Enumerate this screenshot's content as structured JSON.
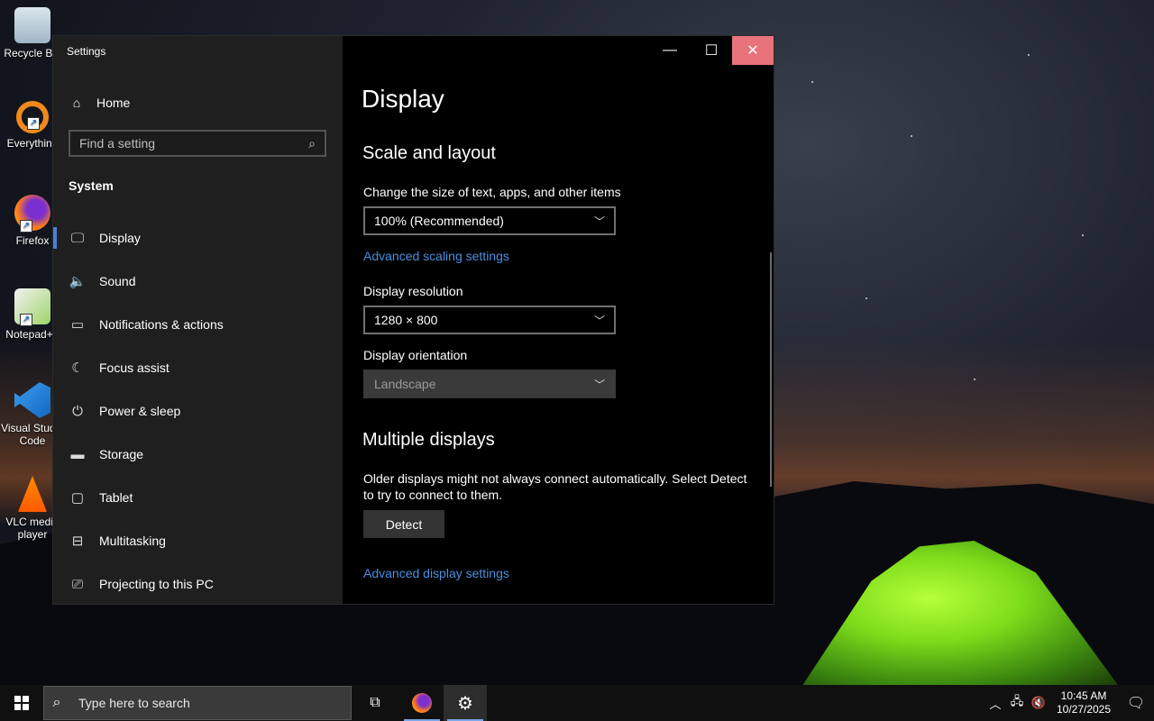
{
  "desktop": {
    "icons": [
      {
        "label": "Recycle Bin"
      },
      {
        "label": "Everything"
      },
      {
        "label": "Firefox"
      },
      {
        "label": "Notepad++"
      },
      {
        "label": "Visual Studio Code"
      },
      {
        "label": "VLC media player"
      }
    ]
  },
  "window": {
    "title": "Settings",
    "controls": {
      "minimize": "—",
      "maximize": "☐",
      "close": "✕"
    }
  },
  "sidebar": {
    "home_label": "Home",
    "search_placeholder": "Find a setting",
    "section_label": "System",
    "items": [
      {
        "label": "Display",
        "icon": "monitor-icon",
        "active": true
      },
      {
        "label": "Sound",
        "icon": "speaker-icon"
      },
      {
        "label": "Notifications & actions",
        "icon": "notifications-icon"
      },
      {
        "label": "Focus assist",
        "icon": "moon-icon"
      },
      {
        "label": "Power & sleep",
        "icon": "power-icon"
      },
      {
        "label": "Storage",
        "icon": "storage-icon"
      },
      {
        "label": "Tablet",
        "icon": "tablet-icon"
      },
      {
        "label": "Multitasking",
        "icon": "multitasking-icon"
      },
      {
        "label": "Projecting to this PC",
        "icon": "projecting-icon"
      }
    ]
  },
  "main": {
    "title": "Display",
    "scale_section": {
      "heading": "Scale and layout",
      "size_label": "Change the size of text, apps, and other items",
      "size_value": "100% (Recommended)",
      "advanced_scaling_link": "Advanced scaling settings",
      "resolution_label": "Display resolution",
      "resolution_value": "1280 × 800",
      "orientation_label": "Display orientation",
      "orientation_value": "Landscape"
    },
    "multi_section": {
      "heading": "Multiple displays",
      "description": "Older displays might not always connect automatically. Select Detect to try to connect to them.",
      "detect_button": "Detect",
      "advanced_display_link": "Advanced display settings"
    }
  },
  "taskbar": {
    "search_placeholder": "Type here to search",
    "clock": {
      "time": "10:45 AM",
      "date": "10/27/2025"
    }
  },
  "colors": {
    "accent": "#4a7fd9",
    "link": "#4a8fe0",
    "close_hover": "#e8737a"
  }
}
